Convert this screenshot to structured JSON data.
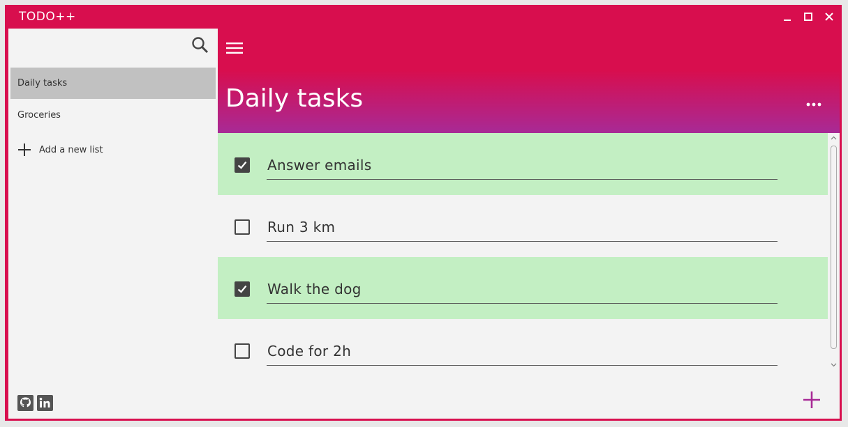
{
  "app": {
    "title": "TODO++"
  },
  "colors": {
    "accent": "#d80e4e",
    "header_gradient_end": "#a82a96",
    "done_row": "#c3efc3",
    "sidebar_active": "#c1c1c1",
    "add_task_plus": "#a82a96"
  },
  "window_controls": [
    "minimize-icon",
    "maximize-icon",
    "close-icon"
  ],
  "sidebar": {
    "search_icon": "search-icon",
    "items": [
      {
        "label": "Daily tasks",
        "active": true
      },
      {
        "label": "Groceries",
        "active": false
      }
    ],
    "add_list_label": "Add a new list",
    "footer_icons": [
      "github-icon",
      "linkedin-icon"
    ]
  },
  "main": {
    "menu_icon": "hamburger-menu-icon",
    "list_title": "Daily tasks",
    "more_icon": "more-horizontal-icon",
    "tasks": [
      {
        "text": "Answer emails",
        "done": true
      },
      {
        "text": "Run 3 km",
        "done": false
      },
      {
        "text": "Walk the dog",
        "done": true
      },
      {
        "text": "Code for 2h",
        "done": false
      }
    ],
    "add_task_icon": "plus-icon"
  }
}
